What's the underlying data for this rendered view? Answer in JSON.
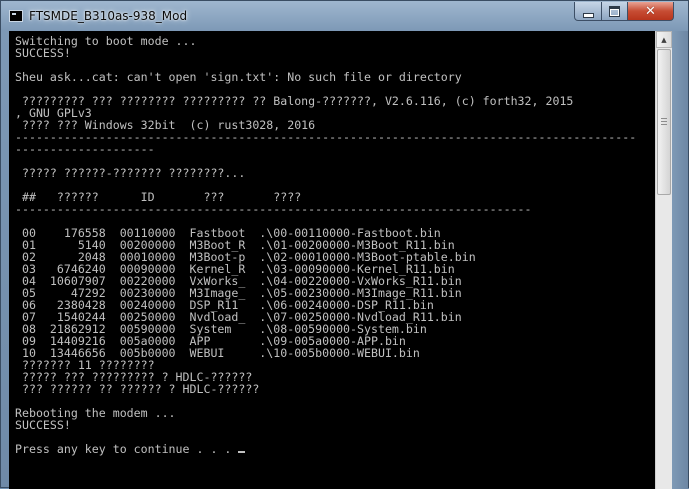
{
  "window": {
    "title": "FTSMDE_B310as-938_Mod",
    "controls": {
      "minimize_icon": "minimize-icon",
      "maximize_icon": "maximize-icon",
      "close_icon": "close-icon",
      "close_glyph": "✕"
    }
  },
  "console": {
    "lines": [
      "Switching to boot mode ...",
      "SUCCESS!",
      "",
      "Sheu ask...cat: can't open 'sign.txt': No such file or directory",
      "",
      " ????????? ??? ???????? ????????? ?? Balong-???????, V2.6.116, (c) forth32, 2015",
      ", GNU GPLv3",
      " ???? ??? Windows 32bit  (c) rust3028, 2016",
      "-----------------------------------------------------------------------------------------",
      "--------------------",
      "",
      " ????? ??????-??????? ????????...",
      "",
      " ##   ??????      ID       ???       ????",
      "--------------------------------------------------------------------------",
      "",
      " 00    176558  00110000  Fastboot  .\\00-00110000-Fastboot.bin",
      " 01      5140  00200000  M3Boot_R  .\\01-00200000-M3Boot_R11.bin",
      " 02      2048  00010000  M3Boot-p  .\\02-00010000-M3Boot-ptable.bin",
      " 03   6746240  00090000  Kernel_R  .\\03-00090000-Kernel_R11.bin",
      " 04  10607907  00220000  VxWorks_  .\\04-00220000-VxWorks_R11.bin",
      " 05     47292  00230000  M3Image_  .\\05-00230000-M3Image_R11.bin",
      " 06   2380428  00240000  DSP_R11   .\\06-00240000-DSP_R11.bin",
      " 07   1540244  00250000  Nvdload_  .\\07-00250000-Nvdload_R11.bin",
      " 08  21862912  00590000  System    .\\08-00590000-System.bin",
      " 09  14409216  005a0000  APP       .\\09-005a0000-APP.bin",
      " 10  13446656  005b0000  WEBUI     .\\10-005b0000-WEBUI.bin",
      " ??????? 11 ????????",
      " ????? ??? ????????? ? HDLC-??????",
      " ??? ?????? ?? ?????? ? HDLC-??????",
      "",
      "Rebooting the modem ...",
      "SUCCESS!",
      "",
      "Press any key to continue . . . "
    ]
  },
  "scrollbar": {
    "up_glyph": "▲"
  },
  "colors": {
    "console_bg": "#000000",
    "console_fg": "#c0c0c0",
    "title_bar": "#9fb7cf",
    "close_button": "#c74d34"
  }
}
